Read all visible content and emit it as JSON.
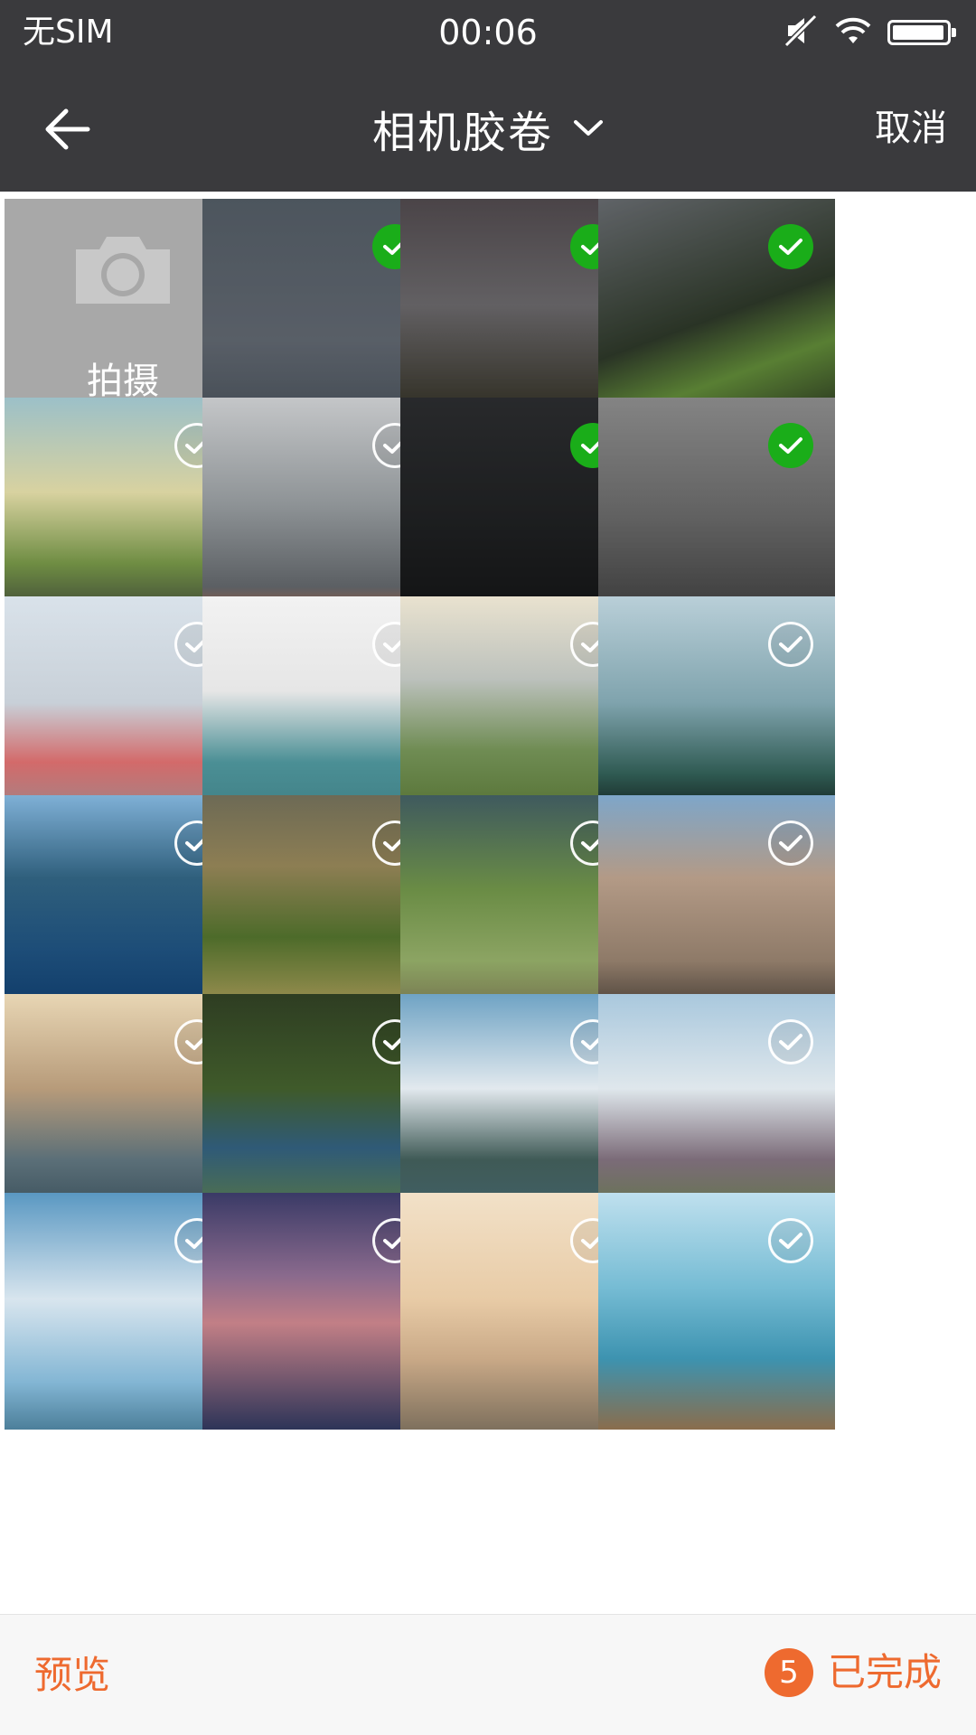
{
  "status_bar": {
    "carrier": "无SIM",
    "time": "00:06",
    "battery_level": 0.96
  },
  "header": {
    "title": "相机胶卷",
    "cancel_label": "取消"
  },
  "camera_tile": {
    "label": "拍摄"
  },
  "grid": {
    "items": [
      {
        "name": "fighter-jet",
        "selected": true,
        "bg": "linear-gradient(180deg,#6e7a86 0%,#7f8894 60%,#5d6874 100%)"
      },
      {
        "name": "missile",
        "selected": true,
        "bg": "linear-gradient(180deg,#6b6267 0%,#8d8a8e 45%,#4d4a3d 85%,#2f2b22 100%)"
      },
      {
        "name": "green-sports-car",
        "selected": true,
        "bg": "linear-gradient(160deg,#8a8f95 0%,#3c4a36 50%,#7fb64a 70%,#2b3427 100%)"
      },
      {
        "name": "motorcycle",
        "selected": false,
        "bg": "linear-gradient(180deg,#9cc0c8 0%,#d8d2a0 40%,#6f8d43 70%,#2c2f33 100%)"
      },
      {
        "name": "city-skyscrapers",
        "selected": false,
        "bg": "linear-gradient(180deg,#c4c6c8 0%,#8e9396 45%,#5b5f63 80%,#c2552a 100%)"
      },
      {
        "name": "black-suv",
        "selected": true,
        "bg": "linear-gradient(180deg,#3a3c3f 0%,#2a2c2e 50%,#18191a 100%)"
      },
      {
        "name": "woman-portrait-bw",
        "selected": true,
        "bg": "linear-gradient(180deg,#bdbdbd 0%,#8c8c8c 50%,#4a4a4a 100%)"
      },
      {
        "name": "woman-pink-dress",
        "selected": false,
        "bg": "linear-gradient(180deg,#d9e2ea 0%,#c8d0d8 45%,#d36a6a 70%,#8f8f92 100%)"
      },
      {
        "name": "woman-teal-dress",
        "selected": false,
        "bg": "linear-gradient(180deg,#f2f2f2 0%,#e6e6e6 40%,#4b8f95 70%,#3c7a80 100%)"
      },
      {
        "name": "misty-meadow",
        "selected": false,
        "bg": "linear-gradient(180deg,#e9e2cf 0%,#bcc1bc 35%,#6f8c53 65%,#4e6a2c 100%)"
      },
      {
        "name": "mountain-lake",
        "selected": false,
        "bg": "linear-gradient(180deg,#b9cfd8 0%,#7fa3ad 45%,#2f5a52 75%,#060606 100%)"
      },
      {
        "name": "blue-fjord",
        "selected": false,
        "bg": "linear-gradient(180deg,#7fb0d6 0%,#2f5f7c 35%,#1d4d78 65%,#0b3563 100%)"
      },
      {
        "name": "tree-lined-road",
        "selected": false,
        "bg": "linear-gradient(180deg,#6d6a55 0%,#8d7e53 30%,#4d6b2a 60%,#b89d60 100%)"
      },
      {
        "name": "wooden-path",
        "selected": false,
        "bg": "linear-gradient(180deg,#3f5a5e 0%,#6a8c45 40%,#8ca463 70%,#6b5e45 100%)"
      },
      {
        "name": "desert-road",
        "selected": false,
        "bg": "linear-gradient(180deg,#7ea6c9 0%,#b39a86 35%,#8e7a68 70%,#2b2622 100%)"
      },
      {
        "name": "coastal-rocks",
        "selected": false,
        "bg": "linear-gradient(180deg,#e8d6b4 0%,#b79b7a 40%,#5b6f78 70%,#2f4551 100%)"
      },
      {
        "name": "winding-road",
        "selected": false,
        "bg": "linear-gradient(180deg,#2e3d22 0%,#3f5a2a 40%,#2f5a77 65%,#5f7c3b 100%)"
      },
      {
        "name": "cloudy-volcano",
        "selected": false,
        "bg": "linear-gradient(180deg,#6fa3c4 0%,#e2e9ee 40%,#3f5a56 70%,#42626c 100%)"
      },
      {
        "name": "hillside-village",
        "selected": false,
        "bg": "linear-gradient(180deg,#a9c8dd 0%,#dfe7ec 40%,#7b6b78 70%,#5d7a3f 100%)"
      },
      {
        "name": "sky-clouds-sea",
        "selected": false,
        "bg": "linear-gradient(180deg,#5a98c2 0%,#d8e5ee 45%,#83b6d4 80%,#4c7f9a 100%)"
      },
      {
        "name": "purple-dusk",
        "selected": false,
        "bg": "linear-gradient(180deg,#3a3a66 0%,#8a6a8d 35%,#c27f86 55%,#2d3458 100%)"
      },
      {
        "name": "hazy-sunset",
        "selected": false,
        "bg": "linear-gradient(180deg,#f2e1c8 0%,#e8cba6 45%,#c9a987 70%,#7e705d 100%)"
      },
      {
        "name": "seaweed-beach",
        "selected": false,
        "bg": "linear-gradient(180deg,#bfe0ee 0%,#76bcd4 40%,#3d93b0 70%,#8a6d4c 100%)"
      }
    ]
  },
  "footer": {
    "preview_label": "预览",
    "selected_count": "5",
    "done_label": "已完成"
  },
  "colors": {
    "bar_bg": "#3a3a3d",
    "accent": "#ee6a2f",
    "check_selected": "#1aad19"
  }
}
